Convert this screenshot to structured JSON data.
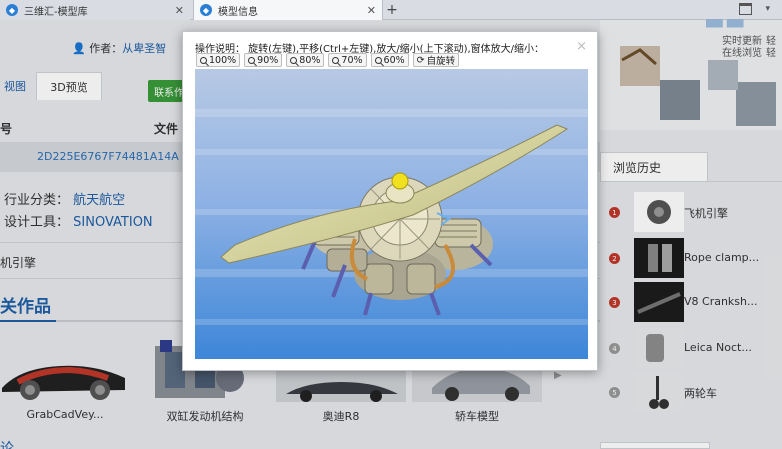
{
  "browser": {
    "tabs": [
      {
        "title": "三维汇-模型库",
        "active": false
      },
      {
        "title": "模型信息",
        "active": true
      }
    ],
    "new_tab": "+"
  },
  "page": {
    "author_label": "作者：",
    "author_name": "从卑圣智",
    "view_tabs": [
      "视图",
      "3D预览"
    ],
    "green_button": "联系作",
    "file_header": [
      "号",
      "文件"
    ],
    "hash": "2D225E6767F74481A14A",
    "industry_label": "行业分类：",
    "industry_value": "航天航空",
    "tool_label": "设计工具：",
    "tool_value": "SINOVATION",
    "engine_text": "机引擎",
    "related_title": "关作品",
    "related": [
      {
        "label": "GrabCadVey...",
        "icon": "sports-car-thumb"
      },
      {
        "label": "双缸发动机结构",
        "icon": "engine-thumb"
      },
      {
        "label": "奥迪R8",
        "icon": "car-thumb"
      },
      {
        "label": "轿车模型",
        "icon": "car-model-thumb"
      }
    ],
    "bottom_text": "论"
  },
  "sidebar": {
    "banner_lines": [
      "实时更新",
      "在线浏览"
    ],
    "banner_extra": [
      "轻",
      "轻"
    ],
    "history_title": "浏览历史",
    "history": [
      {
        "rank": "1",
        "label": "飞机引擎",
        "color": "#c0392b"
      },
      {
        "rank": "2",
        "label": "Rope clamp...",
        "color": "#c0392b"
      },
      {
        "rank": "3",
        "label": "V8 Cranksh...",
        "color": "#c0392b"
      },
      {
        "rank": "4",
        "label": "Leica Noct...",
        "color": "#999999"
      },
      {
        "rank": "5",
        "label": "两轮车",
        "color": "#999999"
      }
    ]
  },
  "modal": {
    "help": "操作说明：  旋转(左键),平移(Ctrl+左键),放大/缩小(上下滚动),窗体放大/缩小：",
    "close": "×",
    "zoom_buttons": [
      "100%",
      "90%",
      "80%",
      "70%",
      "60%"
    ],
    "auto_rotate": "自旋转",
    "colors": {
      "sky_top": "#b7c9e4",
      "sky_bottom": "#3d86d8",
      "propeller": "#d9d6a0",
      "engine": "#d8d3b8",
      "hub": "#f0e020"
    }
  }
}
